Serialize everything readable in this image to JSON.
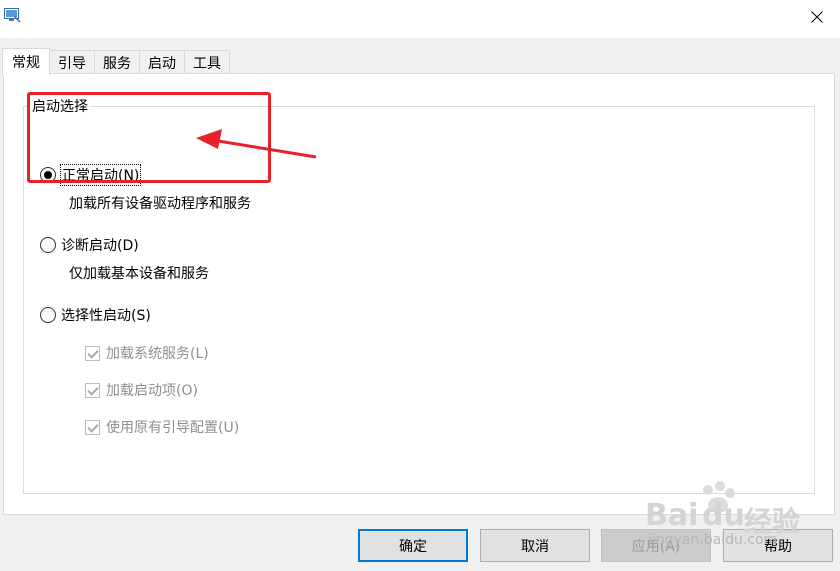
{
  "window": {
    "app_icon": "system-config-icon",
    "close_icon": "close-icon"
  },
  "tabs": [
    {
      "label": "常规",
      "active": true
    },
    {
      "label": "引导",
      "active": false
    },
    {
      "label": "服务",
      "active": false
    },
    {
      "label": "启动",
      "active": false
    },
    {
      "label": "工具",
      "active": false
    }
  ],
  "startup_group": {
    "legend": "启动选择",
    "normal": {
      "label": "正常启动(N)",
      "checked": true,
      "description": "加载所有设备驱动程序和服务"
    },
    "diagnostic": {
      "label": "诊断启动(D)",
      "checked": false,
      "description": "仅加载基本设备和服务"
    },
    "selective": {
      "label": "选择性启动(S)",
      "checked": false,
      "options": [
        {
          "label": "加载系统服务(L)",
          "checked": true,
          "enabled": false
        },
        {
          "label": "加载启动项(O)",
          "checked": true,
          "enabled": false
        },
        {
          "label": "使用原有引导配置(U)",
          "checked": true,
          "enabled": false
        }
      ]
    }
  },
  "buttons": {
    "ok": "确定",
    "cancel": "取消",
    "apply": "应用(A)",
    "help": "帮助"
  },
  "annotation": {
    "color": "#e8202a"
  },
  "watermark": {
    "brand": "Bai",
    "brand2": "du",
    "text": "经验",
    "url": "jingyan.baidu.com"
  }
}
